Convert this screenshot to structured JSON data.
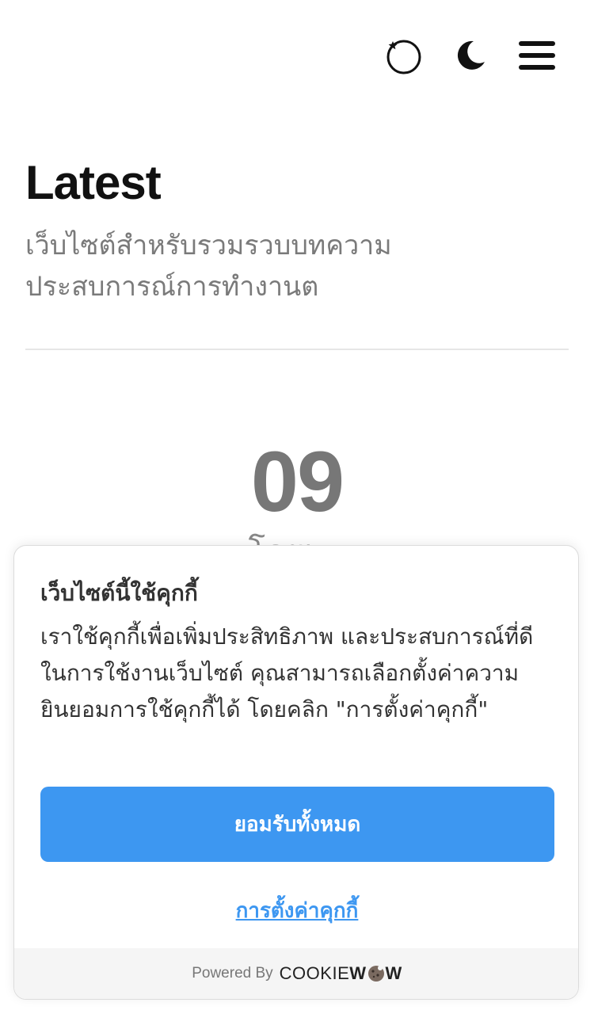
{
  "header": {
    "icons": [
      "loading-spinner-icon",
      "moon-icon",
      "menu-icon"
    ]
  },
  "hero": {
    "title": "Latest",
    "subtitle": "เว็บไซต์สำหรับรวมรวบบทความประสบการณ์การทำงานต"
  },
  "post": {
    "day": "09",
    "month_partial": "โดยเ..."
  },
  "cookie_banner": {
    "title": "เว็บไซต์นี้ใช้คุกกี้",
    "message": "เราใช้คุกกี้เพื่อเพิ่มประสิทธิภาพ และประสบการณ์ที่ดีในการใช้งานเว็บไซต์ คุณสามารถเลือกตั้งค่าความยินยอมการใช้คุกกี้ได้ โดยคลิก \"การตั้งค่าคุกกี้\"",
    "accept_label": "ยอมรับทั้งหมด",
    "settings_label": "การตั้งค่าคุกกี้",
    "powered_by": "Powered By",
    "brand_light": "COOKIE",
    "brand_bold_1": "W",
    "brand_bold_2": "W",
    "accent_color": "#3d97f1"
  }
}
